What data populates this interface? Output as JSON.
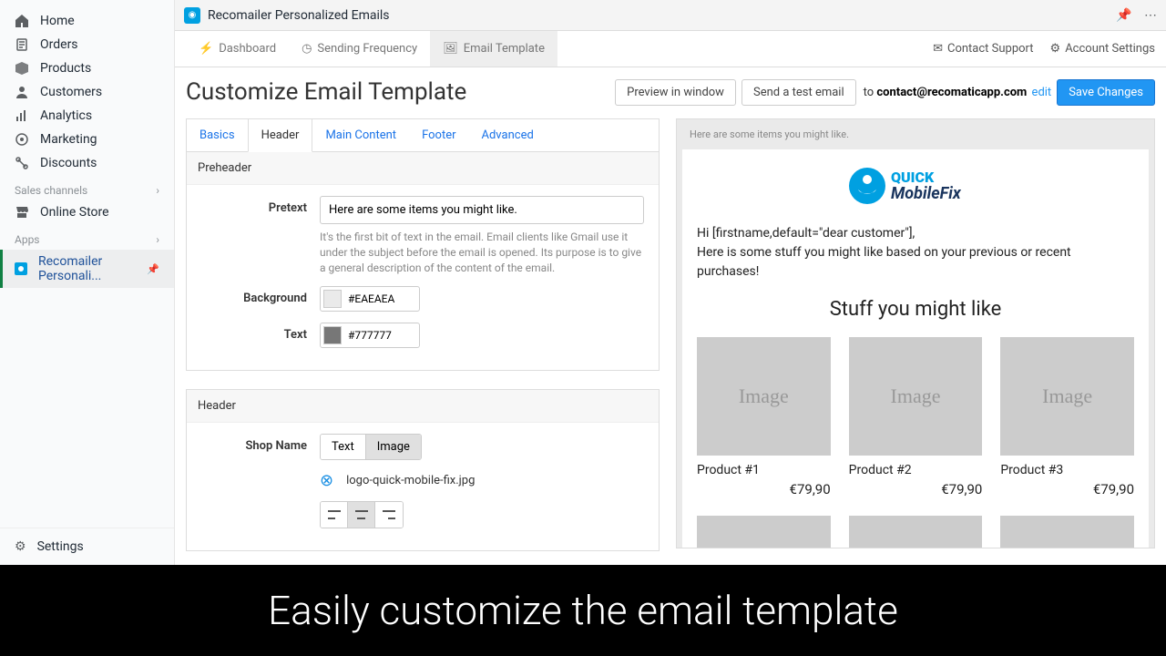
{
  "sidebar": {
    "items": [
      {
        "label": "Home",
        "icon": "home"
      },
      {
        "label": "Orders",
        "icon": "orders"
      },
      {
        "label": "Products",
        "icon": "products"
      },
      {
        "label": "Customers",
        "icon": "customers"
      },
      {
        "label": "Analytics",
        "icon": "analytics"
      },
      {
        "label": "Marketing",
        "icon": "marketing"
      },
      {
        "label": "Discounts",
        "icon": "discounts"
      }
    ],
    "sales_channels_label": "Sales channels",
    "online_store": "Online Store",
    "apps_label": "Apps",
    "active_app": "Recomailer Personali...",
    "settings": "Settings"
  },
  "topbar": {
    "app_name": "Recomailer Personalized Emails"
  },
  "tabs": {
    "dashboard": "Dashboard",
    "sending": "Sending Frequency",
    "template": "Email Template",
    "contact": "Contact Support",
    "account": "Account Settings"
  },
  "page": {
    "title": "Customize Email Template",
    "preview_btn": "Preview in window",
    "test_btn": "Send a test email",
    "to_prefix": "to ",
    "to_email": "contact@recomaticapp.com",
    "edit": "edit",
    "save": "Save Changes"
  },
  "subtabs": {
    "basics": "Basics",
    "header": "Header",
    "main": "Main Content",
    "footer": "Footer",
    "advanced": "Advanced"
  },
  "preheader": {
    "panel": "Preheader",
    "pretext_label": "Pretext",
    "pretext_value": "Here are some items you might like.",
    "pretext_help": "It's the first bit of text in the email. Email clients like Gmail use it under the subject before the email is opened. Its purpose is to give a general description of the content of the email.",
    "bg_label": "Background",
    "bg_value": "#EAEAEA",
    "text_label": "Text",
    "text_value": "#777777"
  },
  "header_panel": {
    "panel": "Header",
    "shop_name_label": "Shop Name",
    "text_opt": "Text",
    "image_opt": "Image",
    "filename": "logo-quick-mobile-fix.jpg"
  },
  "preview": {
    "prehead": "Here are some items you might like.",
    "logo_line1": "QUICK",
    "logo_line2": "MobileFix",
    "greeting": "Hi [firstname,default=\"dear customer\"],",
    "intro": "Here is some stuff you might like based on your previous or recent purchases!",
    "heading": "Stuff you might like",
    "img_placeholder": "Image",
    "products": [
      {
        "name": "Product #1",
        "price": "€79,90"
      },
      {
        "name": "Product #2",
        "price": "€79,90"
      },
      {
        "name": "Product #3",
        "price": "€79,90"
      }
    ]
  },
  "caption": "Easily customize the email template"
}
